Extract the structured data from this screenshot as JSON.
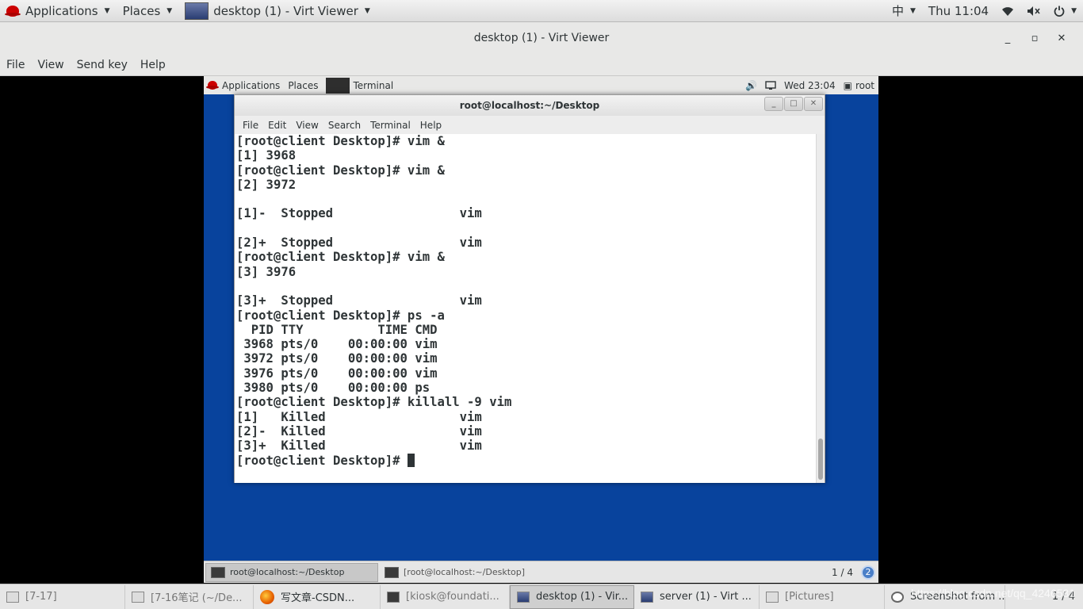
{
  "host_panel": {
    "applications": "Applications",
    "places": "Places",
    "window_title": "desktop (1) - Virt Viewer",
    "input_method": "中",
    "clock": "Thu 11:04"
  },
  "viewer": {
    "title": "desktop (1) - Virt Viewer",
    "menu": [
      "File",
      "View",
      "Send key",
      "Help"
    ]
  },
  "guest_panel": {
    "applications": "Applications",
    "places": "Places",
    "terminal": "Terminal",
    "clock": "Wed 23:04",
    "user": "root"
  },
  "terminal": {
    "title": "root@localhost:~/Desktop",
    "menu": [
      "File",
      "Edit",
      "View",
      "Search",
      "Terminal",
      "Help"
    ],
    "lines": [
      "[root@client Desktop]# vim &",
      "[1] 3968",
      "[root@client Desktop]# vim &",
      "[2] 3972",
      "",
      "[1]-  Stopped                 vim",
      "",
      "[2]+  Stopped                 vim",
      "[root@client Desktop]# vim &",
      "[3] 3976",
      "",
      "[3]+  Stopped                 vim",
      "[root@client Desktop]# ps -a",
      "  PID TTY          TIME CMD",
      " 3968 pts/0    00:00:00 vim",
      " 3972 pts/0    00:00:00 vim",
      " 3976 pts/0    00:00:00 vim",
      " 3980 pts/0    00:00:00 ps",
      "[root@client Desktop]# killall -9 vim",
      "[1]   Killed                  vim",
      "[2]-  Killed                  vim",
      "[3]+  Killed                  vim"
    ],
    "prompt": "[root@client Desktop]# "
  },
  "guest_taskbar": {
    "items": [
      "root@localhost:~/Desktop",
      "[root@localhost:~/Desktop]"
    ],
    "pager": "1 / 4",
    "notifications": "2"
  },
  "host_taskbar": {
    "items": [
      "[7-17]",
      "[7-16笔记 (~/De...",
      "写文章-CSDN...",
      "[kiosk@foundati...",
      "desktop (1) - Vir...",
      "server (1) - Virt ...",
      "[Pictures]",
      "Screenshot from ..."
    ],
    "pager": "1 / 4",
    "watermark": "https://blog.csdn.net/qq_4246581"
  }
}
